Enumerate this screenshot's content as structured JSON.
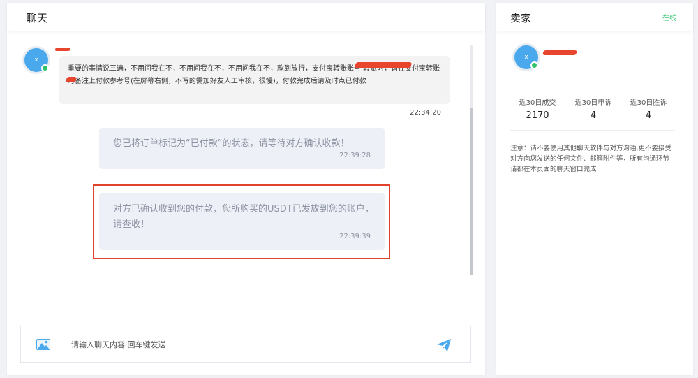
{
  "chat": {
    "title": "聊天",
    "peer_avatar_letter": "x",
    "peer_message": "重要的事情说三遍，不用问我在不，不用问我在不，不用问我在不，款到放行，支付宝转账账号 转账时，请在支付宝转账时备注上付款参考号(在屏幕右侧，不写的需加好友人工审核，很慢)，付款完成后请及时点已付款",
    "peer_message_time": "22:34:20",
    "system_messages": [
      {
        "text": "您已将订单标记为“已付款”的状态，请等待对方确认收款！",
        "time": "22:39:28"
      },
      {
        "text": "对方已确认收到您的付款，您所购买的USDT已发放到您的账户，请查收！",
        "time": "22:39:39"
      }
    ],
    "input_placeholder": "请输入聊天内容 回车键发送",
    "icons": {
      "image": "image-icon",
      "send": "send-icon"
    }
  },
  "seller": {
    "title": "卖家",
    "status": "在线",
    "avatar_letter": "x",
    "stats": [
      {
        "label": "近30日成交",
        "value": "2170"
      },
      {
        "label": "近30日申诉",
        "value": "4"
      },
      {
        "label": "近30日胜诉",
        "value": "4"
      }
    ],
    "notice": "注意：请不要使用其他聊天软件与对方沟通,更不要接受 对方向您发送的任何文件、邮箱附件等，所有沟通环节 请都在本页面的聊天窗口完成"
  },
  "colors": {
    "accent_blue": "#4aa8ec",
    "online_green": "#2fc26b",
    "highlight_red": "#e0422c"
  }
}
